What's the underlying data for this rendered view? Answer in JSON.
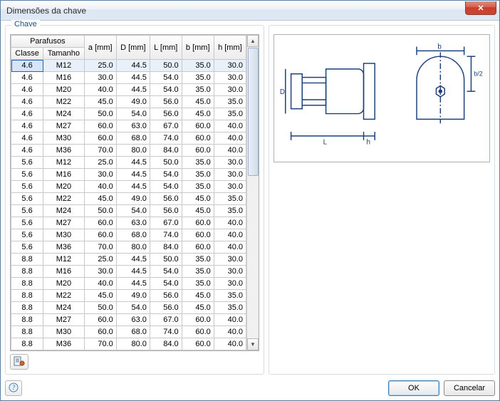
{
  "window": {
    "title": "Dimensões da chave",
    "close_symbol": "✕"
  },
  "group": {
    "title": "Chave"
  },
  "table": {
    "header_group": "Parafusos",
    "columns": [
      "Classe",
      "Tamanho",
      "a [mm]",
      "D [mm]",
      "L [mm]",
      "b [mm]",
      "h [mm]"
    ],
    "rows": [
      [
        "4.6",
        "M12",
        "25.0",
        "44.5",
        "50.0",
        "35.0",
        "30.0"
      ],
      [
        "4.6",
        "M16",
        "30.0",
        "44.5",
        "54.0",
        "35.0",
        "30.0"
      ],
      [
        "4.6",
        "M20",
        "40.0",
        "44.5",
        "54.0",
        "35.0",
        "30.0"
      ],
      [
        "4.6",
        "M22",
        "45.0",
        "49.0",
        "56.0",
        "45.0",
        "35.0"
      ],
      [
        "4.6",
        "M24",
        "50.0",
        "54.0",
        "56.0",
        "45.0",
        "35.0"
      ],
      [
        "4.6",
        "M27",
        "60.0",
        "63.0",
        "67.0",
        "60.0",
        "40.0"
      ],
      [
        "4.6",
        "M30",
        "60.0",
        "68.0",
        "74.0",
        "60.0",
        "40.0"
      ],
      [
        "4.6",
        "M36",
        "70.0",
        "80.0",
        "84.0",
        "60.0",
        "40.0"
      ],
      [
        "5.6",
        "M12",
        "25.0",
        "44.5",
        "50.0",
        "35.0",
        "30.0"
      ],
      [
        "5.6",
        "M16",
        "30.0",
        "44.5",
        "54.0",
        "35.0",
        "30.0"
      ],
      [
        "5.6",
        "M20",
        "40.0",
        "44.5",
        "54.0",
        "35.0",
        "30.0"
      ],
      [
        "5.6",
        "M22",
        "45.0",
        "49.0",
        "56.0",
        "45.0",
        "35.0"
      ],
      [
        "5.6",
        "M24",
        "50.0",
        "54.0",
        "56.0",
        "45.0",
        "35.0"
      ],
      [
        "5.6",
        "M27",
        "60.0",
        "63.0",
        "67.0",
        "60.0",
        "40.0"
      ],
      [
        "5.6",
        "M30",
        "60.0",
        "68.0",
        "74.0",
        "60.0",
        "40.0"
      ],
      [
        "5.6",
        "M36",
        "70.0",
        "80.0",
        "84.0",
        "60.0",
        "40.0"
      ],
      [
        "8.8",
        "M12",
        "25.0",
        "44.5",
        "50.0",
        "35.0",
        "30.0"
      ],
      [
        "8.8",
        "M16",
        "30.0",
        "44.5",
        "54.0",
        "35.0",
        "30.0"
      ],
      [
        "8.8",
        "M20",
        "40.0",
        "44.5",
        "54.0",
        "35.0",
        "30.0"
      ],
      [
        "8.8",
        "M22",
        "45.0",
        "49.0",
        "56.0",
        "45.0",
        "35.0"
      ],
      [
        "8.8",
        "M24",
        "50.0",
        "54.0",
        "56.0",
        "45.0",
        "35.0"
      ],
      [
        "8.8",
        "M27",
        "60.0",
        "63.0",
        "67.0",
        "60.0",
        "40.0"
      ],
      [
        "8.8",
        "M30",
        "60.0",
        "68.0",
        "74.0",
        "60.0",
        "40.0"
      ],
      [
        "8.8",
        "M36",
        "70.0",
        "80.0",
        "84.0",
        "60.0",
        "40.0"
      ]
    ],
    "selected_row": 0
  },
  "diagram": {
    "labels": {
      "D": "D",
      "L": "L",
      "h": "h",
      "b": "b",
      "b2": "b/2"
    }
  },
  "buttons": {
    "ok": "OK",
    "cancel": "Cancelar"
  },
  "scroll": {
    "up": "▲",
    "down": "▼"
  }
}
